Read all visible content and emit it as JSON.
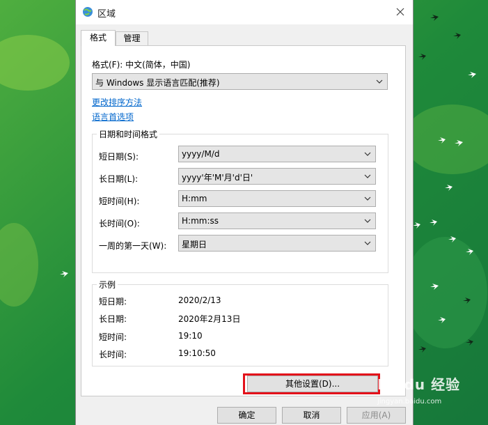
{
  "dialog": {
    "title": "区域"
  },
  "tabs": [
    {
      "label": "格式"
    },
    {
      "label": "管理"
    }
  ],
  "format": {
    "label": "格式(F): 中文(简体，中国)",
    "selected": "与 Windows 显示语言匹配(推荐)",
    "link_sort": "更改排序方法",
    "link_lang": "语言首选项"
  },
  "datetime": {
    "title": "日期和时间格式",
    "rows": [
      {
        "label": "短日期(S):",
        "value": "yyyy/M/d"
      },
      {
        "label": "长日期(L):",
        "value": "yyyy'年'M'月'd'日'"
      },
      {
        "label": "短时间(H):",
        "value": "H:mm"
      },
      {
        "label": "长时间(O):",
        "value": "H:mm:ss"
      },
      {
        "label": "一周的第一天(W):",
        "value": "星期日"
      }
    ]
  },
  "examples": {
    "title": "示例",
    "rows": [
      {
        "label": "短日期:",
        "value": "2020/2/13"
      },
      {
        "label": "长日期:",
        "value": "2020年2月13日"
      },
      {
        "label": "短时间:",
        "value": "19:10"
      },
      {
        "label": "长时间:",
        "value": "19:10:50"
      }
    ]
  },
  "buttons": {
    "other": "其他设置(D)...",
    "ok": "确定",
    "cancel": "取消",
    "apply": "应用(A)"
  },
  "watermark": {
    "brand": "Baidu 经验",
    "url": "jingyan.baidu.com"
  },
  "colors": {
    "highlight": "#e3111a",
    "link": "#0066cc",
    "desktop": "#1f8a3a"
  }
}
